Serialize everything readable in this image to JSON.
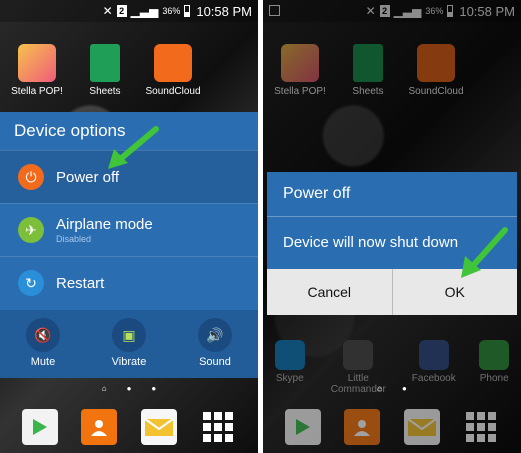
{
  "status": {
    "battery": "36%",
    "time": "10:58 PM",
    "sim": "2"
  },
  "home_apps": [
    {
      "label": "Stella POP!"
    },
    {
      "label": "Sheets"
    },
    {
      "label": "SoundCloud"
    }
  ],
  "device_options": {
    "title": "Device options",
    "items": [
      {
        "label": "Power off",
        "sub": ""
      },
      {
        "label": "Airplane mode",
        "sub": "Disabled"
      },
      {
        "label": "Restart",
        "sub": ""
      }
    ],
    "quick": [
      {
        "label": "Mute"
      },
      {
        "label": "Vibrate"
      },
      {
        "label": "Sound"
      }
    ]
  },
  "dialog": {
    "title": "Power off",
    "message": "Device will now shut down",
    "cancel": "Cancel",
    "ok": "OK"
  },
  "right_apps": [
    {
      "label": "Skype"
    },
    {
      "label": "Little Commander"
    },
    {
      "label": "Facebook"
    },
    {
      "label": "Phone"
    }
  ],
  "colors": {
    "panel_blue": "#2a6db0",
    "arrow_green": "#3fc43a",
    "power_orange": "#f26b1d",
    "airplane_green": "#7cbf3a",
    "restart_blue": "#2a8fd8"
  }
}
